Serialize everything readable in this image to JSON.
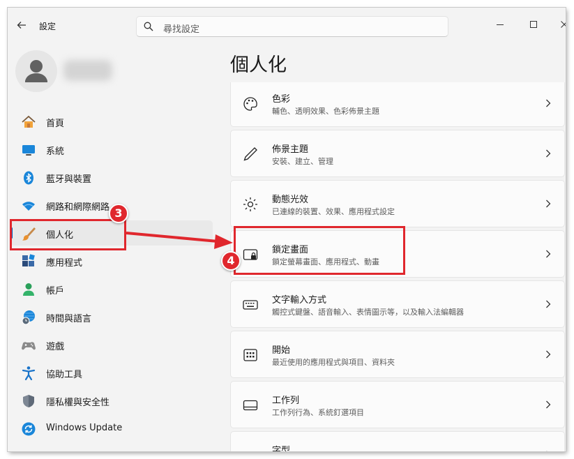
{
  "window": {
    "title": "設定"
  },
  "search": {
    "placeholder": "尋找設定"
  },
  "page": {
    "title": "個人化"
  },
  "nav": [
    {
      "label": "首頁",
      "icon": "home-icon"
    },
    {
      "label": "系統",
      "icon": "monitor-icon"
    },
    {
      "label": "藍牙與裝置",
      "icon": "bluetooth-icon"
    },
    {
      "label": "網路和網際網路",
      "icon": "wifi-icon"
    },
    {
      "label": "個人化",
      "icon": "brush-icon",
      "selected": true
    },
    {
      "label": "應用程式",
      "icon": "apps-icon"
    },
    {
      "label": "帳戶",
      "icon": "person-icon"
    },
    {
      "label": "時間與語言",
      "icon": "globe-clock-icon"
    },
    {
      "label": "遊戲",
      "icon": "gamepad-icon"
    },
    {
      "label": "協助工具",
      "icon": "accessibility-icon"
    },
    {
      "label": "隱私權與安全性",
      "icon": "shield-icon"
    },
    {
      "label": "Windows Update",
      "icon": "update-icon"
    }
  ],
  "cards": [
    {
      "title": "色彩",
      "desc": "輔色、透明效果、色彩佈景主題",
      "icon": "palette-icon"
    },
    {
      "title": "佈景主題",
      "desc": "安裝、建立、管理",
      "icon": "pen-icon"
    },
    {
      "title": "動態光效",
      "desc": "已連線的裝置、效果、應用程式設定",
      "icon": "lighting-icon"
    },
    {
      "title": "鎖定畫面",
      "desc": "鎖定螢幕畫面、應用程式、動畫",
      "icon": "lock-screen-icon"
    },
    {
      "title": "文字輸入方式",
      "desc": "觸控式鍵盤、語音輸入、表情圖示等，以及輸入法編輯器",
      "icon": "keyboard-icon"
    },
    {
      "title": "開始",
      "desc": "最近使用的應用程式與項目、資料夾",
      "icon": "start-icon"
    },
    {
      "title": "工作列",
      "desc": "工作列行為、系統釘選項目",
      "icon": "taskbar-icon"
    },
    {
      "title": "字型",
      "desc": "",
      "icon": "font-icon"
    }
  ],
  "annotations": {
    "step3": "3",
    "step4": "4",
    "color": "#e0272d"
  },
  "colors": {
    "accent": "#005fb8",
    "annotation": "#e0272d"
  }
}
